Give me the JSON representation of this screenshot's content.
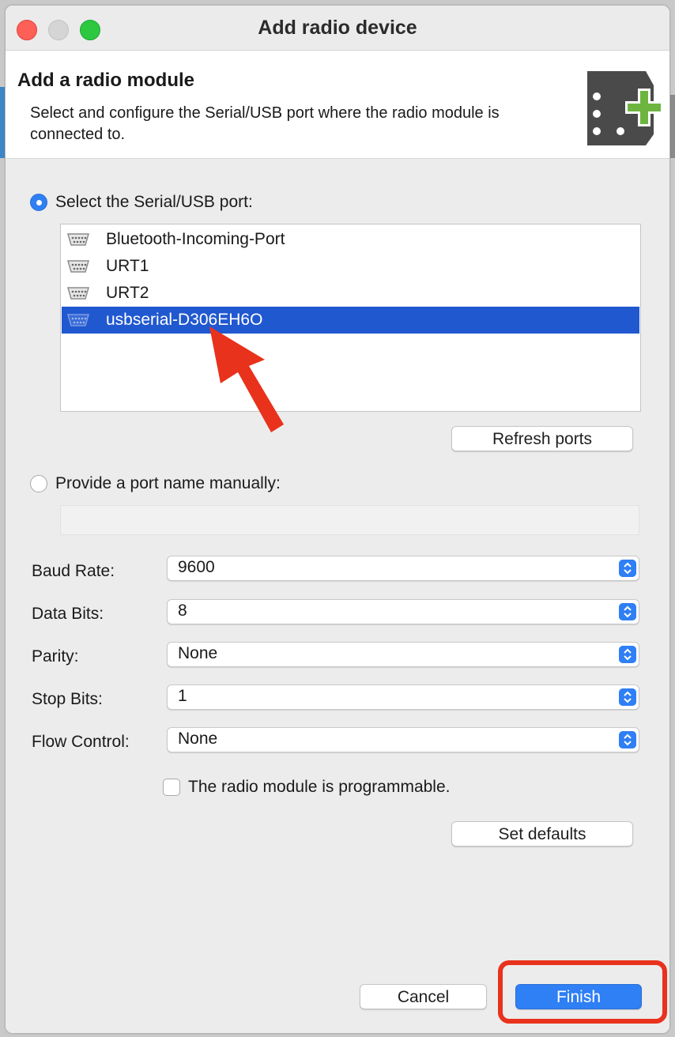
{
  "window": {
    "title": "Add radio device"
  },
  "header": {
    "title": "Add a radio module",
    "description": "Select and configure the Serial/USB port where the radio module is connected to.",
    "icon": "radio-module-add-icon"
  },
  "port_selection": {
    "serial_option_label": "Select the Serial/USB port:",
    "serial_option_selected": true,
    "ports": [
      {
        "name": "Bluetooth-Incoming-Port",
        "icon": "serial-port-icon",
        "selected": false
      },
      {
        "name": "URT1",
        "icon": "serial-port-icon",
        "selected": false
      },
      {
        "name": "URT2",
        "icon": "serial-port-icon",
        "selected": false
      },
      {
        "name": "usbserial-D306EH6O",
        "icon": "serial-port-icon",
        "selected": true
      }
    ],
    "refresh_label": "Refresh ports",
    "manual_option_label": "Provide a port name manually:",
    "manual_option_selected": false,
    "manual_port_value": ""
  },
  "settings": {
    "baud_rate": {
      "label": "Baud Rate:",
      "value": "9600"
    },
    "data_bits": {
      "label": "Data Bits:",
      "value": "8"
    },
    "parity": {
      "label": "Parity:",
      "value": "None"
    },
    "stop_bits": {
      "label": "Stop Bits:",
      "value": "1"
    },
    "flow_control": {
      "label": "Flow Control:",
      "value": "None"
    }
  },
  "programmable": {
    "label": "The radio module is programmable.",
    "checked": false
  },
  "set_defaults_label": "Set defaults",
  "footer": {
    "cancel_label": "Cancel",
    "finish_label": "Finish"
  },
  "colors": {
    "accent": "#2f7ff5",
    "selection": "#2058d0",
    "annotation": "#e8321c",
    "icon_green": "#6db53f"
  }
}
